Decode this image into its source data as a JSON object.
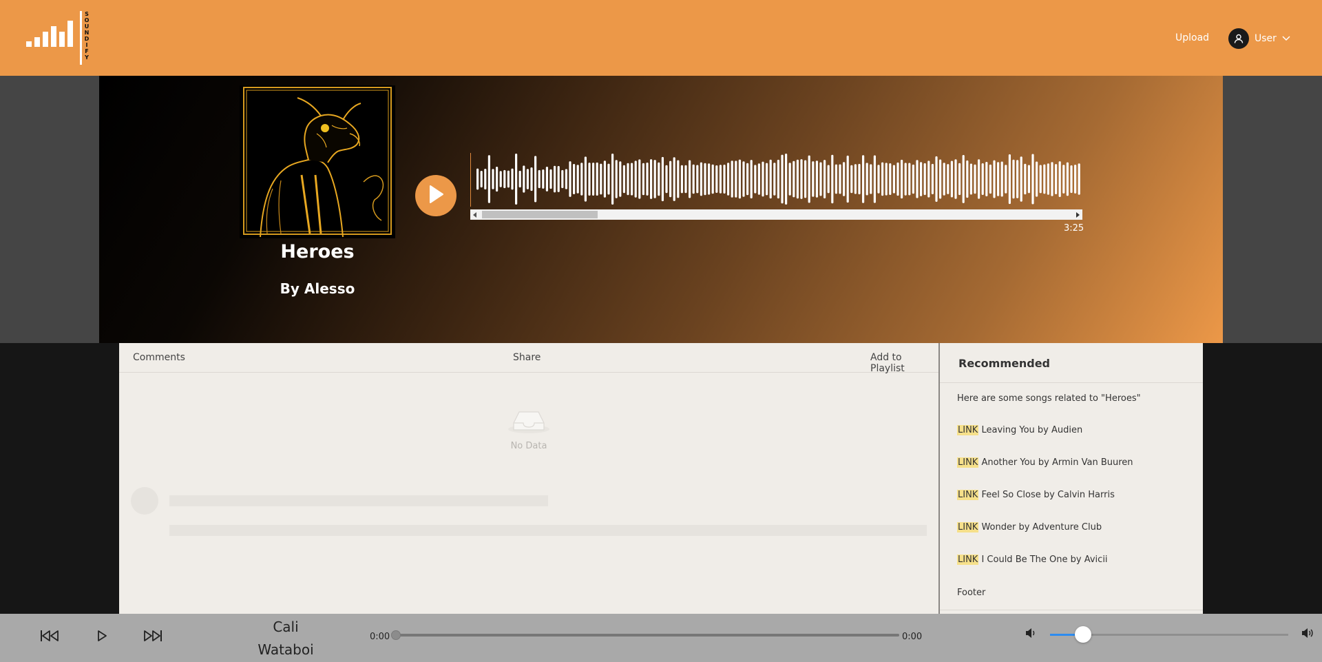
{
  "header": {
    "logo_text": "SOUNDIFY",
    "upload_label": "Upload",
    "user_label": "User"
  },
  "song": {
    "title": "Heroes",
    "artist_line": "By Alesso",
    "duration": "3:25",
    "waveform_scroll_fraction": 0.19
  },
  "tabs": {
    "comments": "Comments",
    "share": "Share",
    "add_to_playlist": "Add to Playlist"
  },
  "comments": {
    "empty_text": "No Data"
  },
  "sidebar": {
    "title": "Recommended",
    "intro": "Here are some songs related to \"Heroes\"",
    "items": [
      {
        "tag": "LINK",
        "text": " Leaving You by Audien"
      },
      {
        "tag": "LINK",
        "text": " Another You by Armin Van Buuren"
      },
      {
        "tag": "LINK",
        "text": " Feel So Close by Calvin Harris"
      },
      {
        "tag": "LINK",
        "text": " Wonder by Adventure Club"
      },
      {
        "tag": "LINK",
        "text": " I Could Be The One by Avicii"
      }
    ],
    "footer": "Footer"
  },
  "player": {
    "now_playing_title": "Cali",
    "now_playing_artist": "Wataboi",
    "current_time": "0:00",
    "total_time": "0:00",
    "volume_fraction": 0.14
  },
  "colors": {
    "accent": "#ec9848",
    "player_bg": "#a9a9a9",
    "volume_fill": "#2d8cf0"
  },
  "icons": {
    "prev": "skip-back-icon",
    "play": "play-icon",
    "next": "skip-forward-icon",
    "volume_low": "volume-low-icon",
    "volume_high": "volume-high-icon",
    "user": "user-icon",
    "chevron": "chevron-down-icon",
    "empty": "inbox-icon"
  }
}
